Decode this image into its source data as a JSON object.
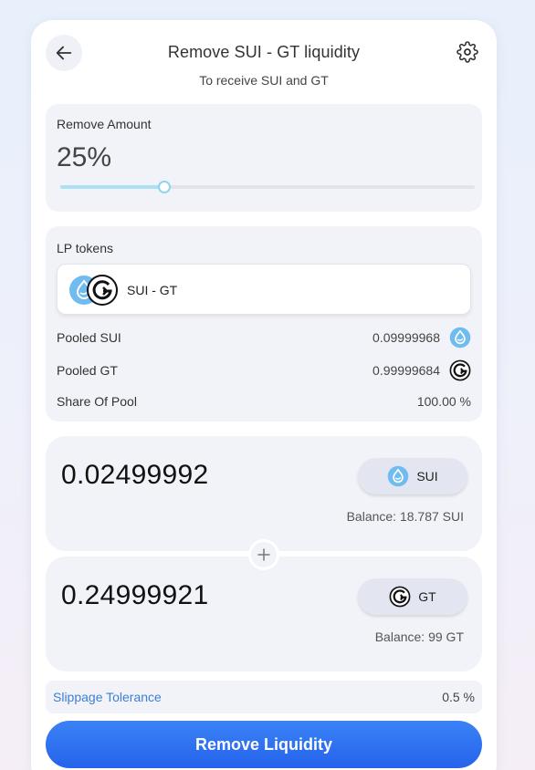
{
  "header": {
    "title": "Remove SUI - GT liquidity",
    "subtitle": "To receive SUI and GT",
    "back_icon": "arrow-left-icon",
    "settings_icon": "gear-icon"
  },
  "remove": {
    "label": "Remove Amount",
    "percent_text": "25%",
    "percent_value": 25
  },
  "lp": {
    "label": "LP tokens",
    "pair_name": "SUI - GT",
    "rows": [
      {
        "label": "Pooled SUI",
        "value": "0.09999968",
        "icon": "sui-token-icon"
      },
      {
        "label": "Pooled GT",
        "value": "0.99999684",
        "icon": "gt-token-icon"
      },
      {
        "label": "Share Of Pool",
        "value": "100.00 %"
      }
    ]
  },
  "outputs": [
    {
      "amount": "0.02499992",
      "token": "SUI",
      "icon": "sui-token-icon",
      "balance": "Balance: 18.787 SUI"
    },
    {
      "amount": "0.24999921",
      "token": "GT",
      "icon": "gt-token-icon",
      "balance": "Balance: 99 GT"
    }
  ],
  "slippage": {
    "label": "Slippage Tolerance",
    "value": "0.5 %"
  },
  "submit_label": "Remove Liquidity",
  "colors": {
    "accent": "#2f74f0",
    "sui_blue": "#6fbcf0",
    "link_blue": "#3b7fd6",
    "slider_fill": "#aee0f4",
    "panel_bg": "#f2f3f8"
  }
}
